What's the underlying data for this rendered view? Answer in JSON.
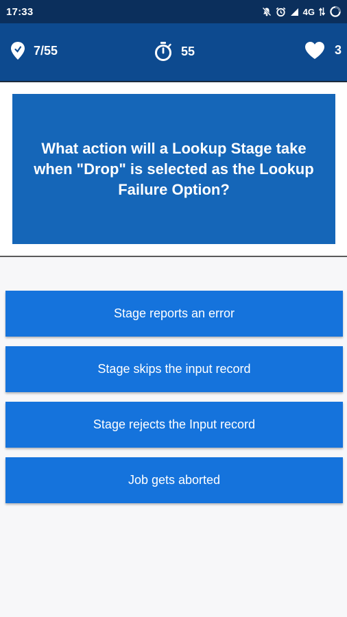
{
  "status_bar": {
    "time": "17:33",
    "network": "4G",
    "icons": [
      "mute-icon",
      "alarm-icon",
      "signal-icon",
      "signal-icon",
      "battery-icon"
    ]
  },
  "header": {
    "progress": "7/55",
    "timer": "55",
    "lives": "3",
    "colors": {
      "status_bar": "#0b2f5c",
      "app_bar": "#0d4a8f"
    }
  },
  "question": {
    "text": "What action will a Lookup Stage take when \"Drop\" is selected as the Lookup Failure Option?",
    "color": "#1566b8"
  },
  "answers": {
    "color": "#1573dc",
    "options": [
      {
        "label": "Stage reports an error"
      },
      {
        "label": "Stage skips the input record"
      },
      {
        "label": "Stage rejects the Input record"
      },
      {
        "label": "Job gets aborted"
      }
    ]
  }
}
